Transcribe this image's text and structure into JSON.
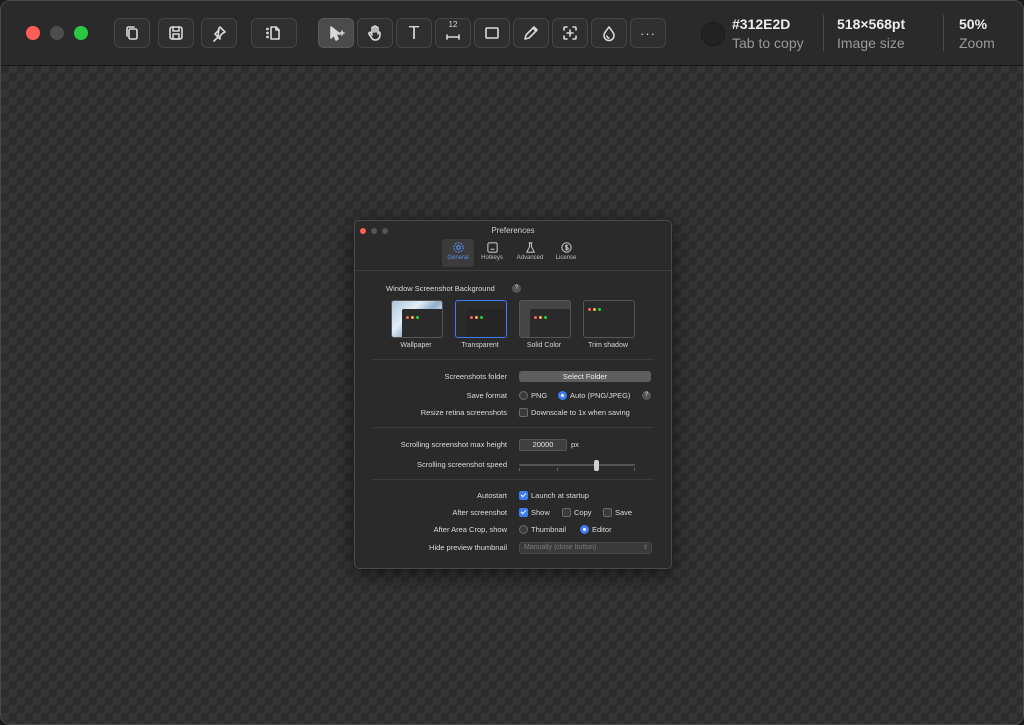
{
  "window": {
    "traffic_lights": [
      "close",
      "minimize",
      "zoom"
    ]
  },
  "toolbar": {
    "text_tool_label": "T",
    "measure_value": "12",
    "more_label": "···",
    "color_hex": "#312E2D",
    "color_hint": "Tab to copy",
    "image_size": "518×568pt",
    "image_size_label": "Image size",
    "zoom_value": "50%",
    "zoom_label": "Zoom"
  },
  "prefs": {
    "title": "Preferences",
    "tabs": [
      {
        "label": "General",
        "icon": "gear-icon"
      },
      {
        "label": "Hotkeys",
        "icon": "keyboard-icon"
      },
      {
        "label": "Advanced",
        "icon": "flask-icon"
      },
      {
        "label": "License",
        "icon": "dollar-icon"
      }
    ],
    "bg_section_label": "Window Screenshot Background",
    "help": "?",
    "bg_options": [
      "Wallpaper",
      "Transparent",
      "Solid Color",
      "Trim shadow"
    ],
    "folder_label": "Screenshots folder",
    "folder_button": "Select Folder",
    "format_label": "Save format",
    "format_png": "PNG",
    "format_auto": "Auto (PNG/JPEG)",
    "retina_label": "Resize retina screenshots",
    "retina_option": "Downscale to 1x when saving",
    "scroll_max_label": "Scrolling screenshot max height",
    "scroll_max_value": "20000",
    "scroll_max_unit": "px",
    "scroll_speed_label": "Scrolling screenshot speed",
    "scroll_speed_level": 0.67,
    "autostart_label": "Autostart",
    "autostart_option": "Launch at startup",
    "after_label": "After screenshot",
    "after_show": "Show",
    "after_copy": "Copy",
    "after_save": "Save",
    "crop_label": "After Area Crop, show",
    "crop_thumbnail": "Thumbnail",
    "crop_editor": "Editor",
    "hide_label": "Hide preview thumbnail",
    "hide_value": "Manually (close button)"
  }
}
